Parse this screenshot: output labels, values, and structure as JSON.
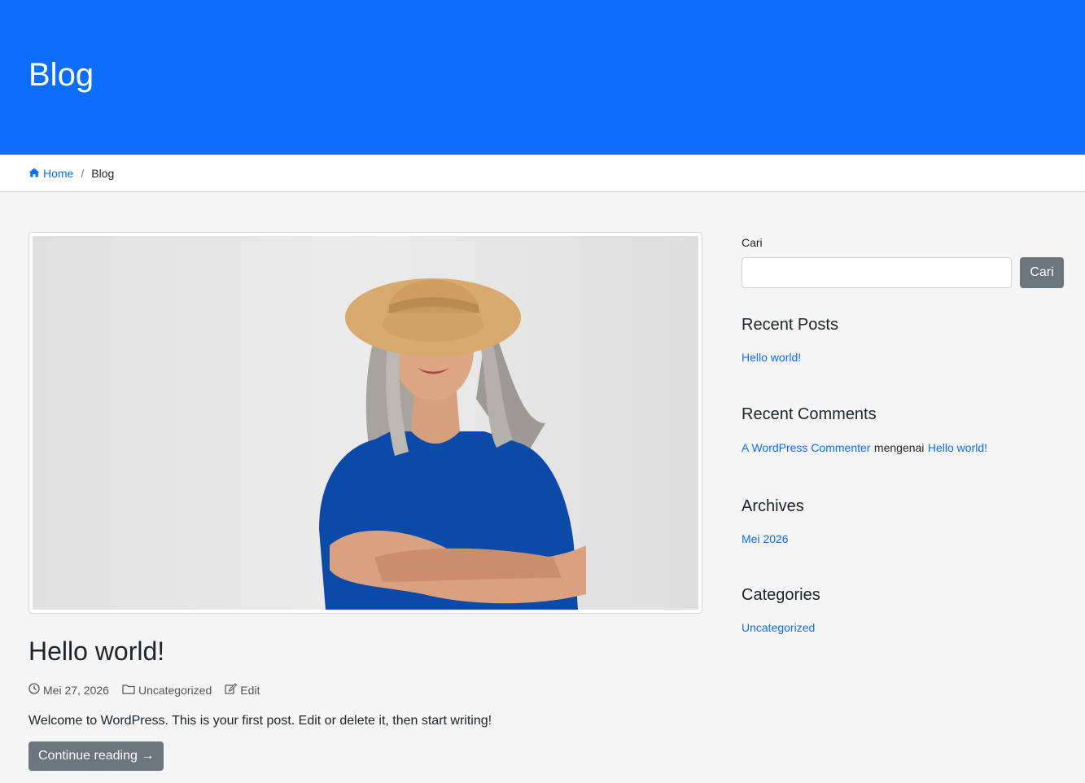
{
  "hero": {
    "title": "Blog"
  },
  "breadcrumb": {
    "home": "Home",
    "separator": "/",
    "current": "Blog"
  },
  "post": {
    "title": "Hello world!",
    "date": "Mei 27, 2026",
    "category": "Uncategorized",
    "edit_label": "Edit",
    "excerpt": "Welcome to WordPress. This is your first post. Edit or delete it, then start writing!",
    "continue_label": "Continue reading →",
    "image_icon": "woman-straw-hat-photo"
  },
  "sidebar": {
    "search_label": "Cari",
    "search_value": "",
    "search_button": "Cari",
    "recent_posts": {
      "title": "Recent Posts",
      "items": [
        "Hello world!"
      ]
    },
    "recent_comments": {
      "title": "Recent Comments",
      "author": "A WordPress Commenter",
      "connector": "mengenai",
      "post": "Hello world!"
    },
    "archives": {
      "title": "Archives",
      "items": [
        "Mei 2026"
      ]
    },
    "categories": {
      "title": "Categories",
      "items": [
        "Uncategorized"
      ]
    }
  },
  "colors": {
    "primary": "#0d6efd",
    "secondary_button": "#6c757d",
    "page_bg": "#f5f5f5"
  }
}
